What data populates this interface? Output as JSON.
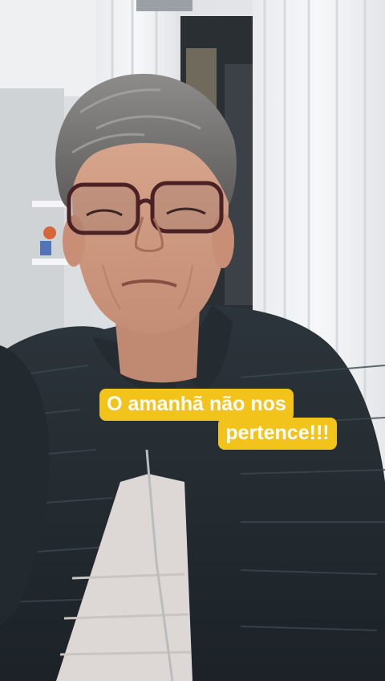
{
  "video": {
    "caption_lines": [
      "O amanhã não nos",
      "pertence!!!"
    ],
    "caption_background": "#f2c31a",
    "caption_text_color": "#ffffff"
  }
}
